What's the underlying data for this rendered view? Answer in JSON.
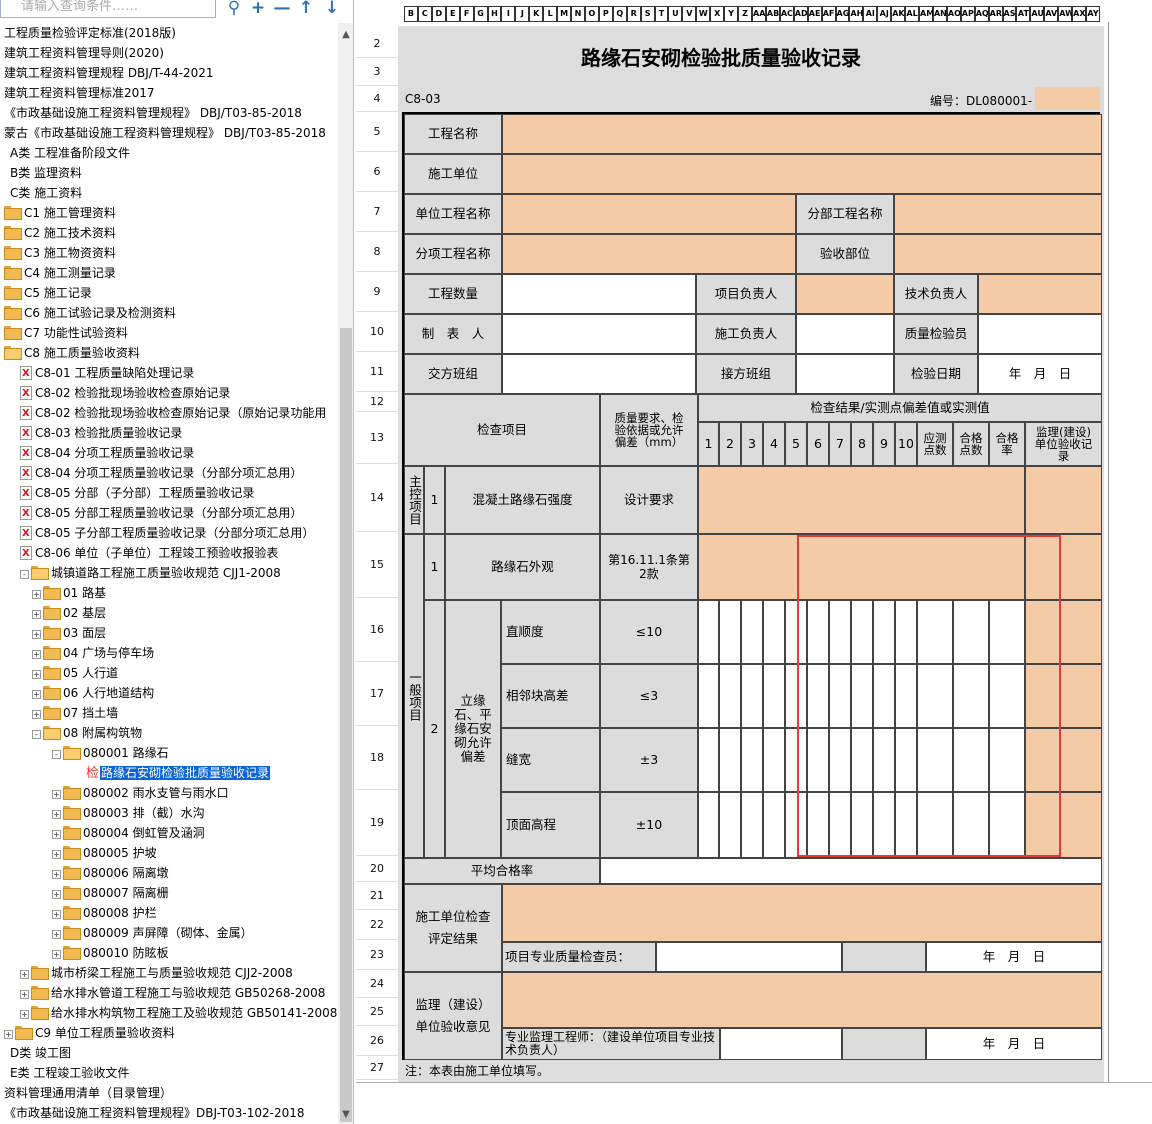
{
  "search": {
    "placeholder": "请输入查询条件……"
  },
  "toolbar": [
    "search-icon",
    "plus-icon",
    "minus-icon",
    "arrow-up-icon",
    "arrow-down-icon"
  ],
  "tree": [
    {
      "label": "工程质量检验评定标准(2018版)",
      "indent": 0,
      "icon": "none"
    },
    {
      "label": "建筑工程资料管理导则(2020)",
      "indent": 0,
      "icon": "none"
    },
    {
      "label": "建筑工程资料管理规程 DBJ/T-44-2021",
      "indent": 0,
      "icon": "none"
    },
    {
      "label": "建筑工程资料管理标准2017",
      "indent": 0,
      "icon": "none"
    },
    {
      "label": "《市政基础设施工程资料管理规程》 DBJ/T03-85-2018",
      "indent": 0,
      "icon": "none"
    },
    {
      "label": "蒙古《市政基础设施工程资料管理规程》 DBJ/T03-85-2018",
      "indent": 0,
      "icon": "none"
    },
    {
      "label": "A类 工程准备阶段文件",
      "indent": 1,
      "icon": "none"
    },
    {
      "label": "B类 监理资料",
      "indent": 1,
      "icon": "none"
    },
    {
      "label": "C类 施工资料",
      "indent": 1,
      "icon": "none"
    },
    {
      "label": "C1 施工管理资料",
      "indent": 2,
      "icon": "folder"
    },
    {
      "label": "C2 施工技术资料",
      "indent": 2,
      "icon": "folder"
    },
    {
      "label": "C3 施工物资资料",
      "indent": 2,
      "icon": "folder"
    },
    {
      "label": "C4 施工测量记录",
      "indent": 2,
      "icon": "folder"
    },
    {
      "label": "C5 施工记录",
      "indent": 2,
      "icon": "folder"
    },
    {
      "label": "C6 施工试验记录及检测资料",
      "indent": 2,
      "icon": "folder"
    },
    {
      "label": "C7 功能性试验资料",
      "indent": 2,
      "icon": "folder"
    },
    {
      "label": "C8 施工质量验收资料",
      "indent": 2,
      "icon": "folder-open"
    },
    {
      "label": "C8-01 工程质量缺陷处理记录",
      "indent": 3,
      "icon": "doc"
    },
    {
      "label": "C8-02 检验批现场验收检查原始记录",
      "indent": 3,
      "icon": "doc"
    },
    {
      "label": "C8-02 检验批现场验收检查原始记录（原始记录功能用",
      "indent": 3,
      "icon": "doc"
    },
    {
      "label": "C8-03 检验批质量验收记录",
      "indent": 3,
      "icon": "doc"
    },
    {
      "label": "C8-04 分项工程质量验收记录",
      "indent": 3,
      "icon": "doc"
    },
    {
      "label": "C8-04 分项工程质量验收记录（分部分项汇总用）",
      "indent": 3,
      "icon": "doc"
    },
    {
      "label": "C8-05 分部（子分部）工程质量验收记录",
      "indent": 3,
      "icon": "doc"
    },
    {
      "label": "C8-05 分部工程质量验收记录（分部分项汇总用）",
      "indent": 3,
      "icon": "doc"
    },
    {
      "label": "C8-05 子分部工程质量验收记录（分部分项汇总用）",
      "indent": 3,
      "icon": "doc"
    },
    {
      "label": "C8-06 单位（子单位）工程竣工预验收报验表",
      "indent": 3,
      "icon": "doc"
    },
    {
      "label": "城镇道路工程施工质量验收规范 CJJ1-2008",
      "indent": 3,
      "icon": "folder-open",
      "pm": "-"
    },
    {
      "label": "01 路基",
      "indent": 4,
      "icon": "folder",
      "pm": "+"
    },
    {
      "label": "02 基层",
      "indent": 4,
      "icon": "folder",
      "pm": "+"
    },
    {
      "label": "03 面层",
      "indent": 4,
      "icon": "folder",
      "pm": "+"
    },
    {
      "label": "04 广场与停车场",
      "indent": 4,
      "icon": "folder",
      "pm": "+"
    },
    {
      "label": "05 人行道",
      "indent": 4,
      "icon": "folder",
      "pm": "+"
    },
    {
      "label": "06 人行地道结构",
      "indent": 4,
      "icon": "folder",
      "pm": "+"
    },
    {
      "label": "07 挡土墙",
      "indent": 4,
      "icon": "folder",
      "pm": "+"
    },
    {
      "label": "08 附属构筑物",
      "indent": 4,
      "icon": "folder-open",
      "pm": "-"
    },
    {
      "label": "080001 路缘石",
      "indent": 5,
      "icon": "folder-open",
      "pm": "-"
    },
    {
      "label": "路缘石安砌检验批质量验收记录",
      "indent": 6,
      "icon": "check",
      "selected": true,
      "prefix": "检"
    },
    {
      "label": "080002 雨水支管与雨水口",
      "indent": 5,
      "icon": "folder",
      "pm": "+"
    },
    {
      "label": "080003 排（截）水沟",
      "indent": 5,
      "icon": "folder",
      "pm": "+"
    },
    {
      "label": "080004 倒虹管及涵洞",
      "indent": 5,
      "icon": "folder",
      "pm": "+"
    },
    {
      "label": "080005 护坡",
      "indent": 5,
      "icon": "folder",
      "pm": "+"
    },
    {
      "label": "080006 隔离墩",
      "indent": 5,
      "icon": "folder",
      "pm": "+"
    },
    {
      "label": "080007 隔离栅",
      "indent": 5,
      "icon": "folder",
      "pm": "+"
    },
    {
      "label": "080008 护栏",
      "indent": 5,
      "icon": "folder",
      "pm": "+"
    },
    {
      "label": "080009 声屏障（砌体、金属）",
      "indent": 5,
      "icon": "folder",
      "pm": "+"
    },
    {
      "label": "080010 防眩板",
      "indent": 5,
      "icon": "folder",
      "pm": "+"
    },
    {
      "label": "城市桥梁工程施工与质量验收规范 CJJ2-2008",
      "indent": 3,
      "icon": "folder",
      "pm": "+"
    },
    {
      "label": "给水排水管道工程施工与验收规范 GB50268-2008",
      "indent": 3,
      "icon": "folder",
      "pm": "+"
    },
    {
      "label": "给水排水构筑物工程施工及验收规范 GB50141-2008",
      "indent": 3,
      "icon": "folder",
      "pm": "+"
    },
    {
      "label": "C9 单位工程质量验收资料",
      "indent": 2,
      "icon": "folder",
      "pm": "+"
    },
    {
      "label": "D类 竣工图",
      "indent": 1,
      "icon": "none"
    },
    {
      "label": "E类 工程竣工验收文件",
      "indent": 1,
      "icon": "none"
    },
    {
      "label": "资料管理通用清单（目录管理）",
      "indent": 0,
      "icon": "none"
    },
    {
      "label": "《市政基础设施工程资料管理规程》DBJ-T03-102-2018",
      "indent": 0,
      "icon": "none"
    }
  ],
  "columns": [
    "B",
    "C",
    "D",
    "E",
    "F",
    "G",
    "H",
    "I",
    "J",
    "K",
    "L",
    "M",
    "N",
    "O",
    "P",
    "Q",
    "R",
    "S",
    "T",
    "U",
    "V",
    "W",
    "X",
    "Y",
    "Z",
    "AA",
    "AB",
    "AC",
    "AD",
    "AE",
    "AF",
    "AG",
    "AH",
    "AI",
    "AJ",
    "AK",
    "AL",
    "AM",
    "AN",
    "AO",
    "AP",
    "AQ",
    "AR",
    "AS",
    "AT",
    "AU",
    "AV",
    "AW",
    "AX",
    "AY"
  ],
  "rows": [
    "2",
    "3",
    "4",
    "5",
    "6",
    "7",
    "8",
    "9",
    "10",
    "11",
    "12",
    "13",
    "14",
    "15",
    "16",
    "17",
    "18",
    "19",
    "20",
    "21",
    "22",
    "23",
    "24",
    "25",
    "26",
    "27"
  ],
  "form": {
    "title": "路缘石安砌检验批质量验收记录",
    "code": "C8-03",
    "serial": "编号：DL080001-",
    "project_name": "工程名称",
    "contractor": "施工单位",
    "unit_project": "单位工程名称",
    "division": "分部工程名称",
    "subitem": "分项工程名称",
    "accept_part": "验收部位",
    "quantity": "工程数量",
    "project_lead": "项目负责人",
    "tech_lead": "技术负责人",
    "preparer": "制　表　人",
    "construction_lead": "施工负责人",
    "quality_inspector": "质量检验员",
    "handover_team": "交方班组",
    "receiver_team": "接方班组",
    "inspect_date": "检验日期",
    "date_ymd": "年　月　日",
    "inspect_items": "检查项目",
    "quality_req": "质量要求、检验依据或允许偏差（mm）",
    "results_header": "检查结果/实测点偏差值或实测值",
    "col_nums": [
      "1",
      "2",
      "3",
      "4",
      "5",
      "6",
      "7",
      "8",
      "9",
      "10"
    ],
    "should_points": "应测点数",
    "pass_points": "合格点数",
    "pass_rate": "合格率",
    "supervisor_record": "监理(建设)单位验收记录",
    "main_ctrl": "主控项目",
    "general": "一般项目",
    "n1": "1",
    "n2": "2",
    "concrete_strength": "混凝土路缘石强度",
    "design_req": "设计要求",
    "appearance": "路缘石外观",
    "appearance_req": "第16.11.1条第2款",
    "tolerance_group": "立缘石、平缘石安砌允许偏差",
    "straightness": "直顺度",
    "straightness_req": "≤10",
    "adjacent_height": "相邻块高差",
    "adjacent_req": "≤3",
    "gap_width": "缝宽",
    "gap_req": "±3",
    "top_elev": "顶面高程",
    "top_req": "±10",
    "avg_pass_rate": "平均合格率",
    "contractor_eval": "施工单位检查评定结果",
    "quality_inspector_sign": "项目专业质量检查员：",
    "supervisor_opinion": "监理（建设）单位验收意见",
    "supervisor_sign": "专业监理工程师：（建设单位项目专业技术负责人）",
    "note": "注：本表由施工单位填写。"
  }
}
